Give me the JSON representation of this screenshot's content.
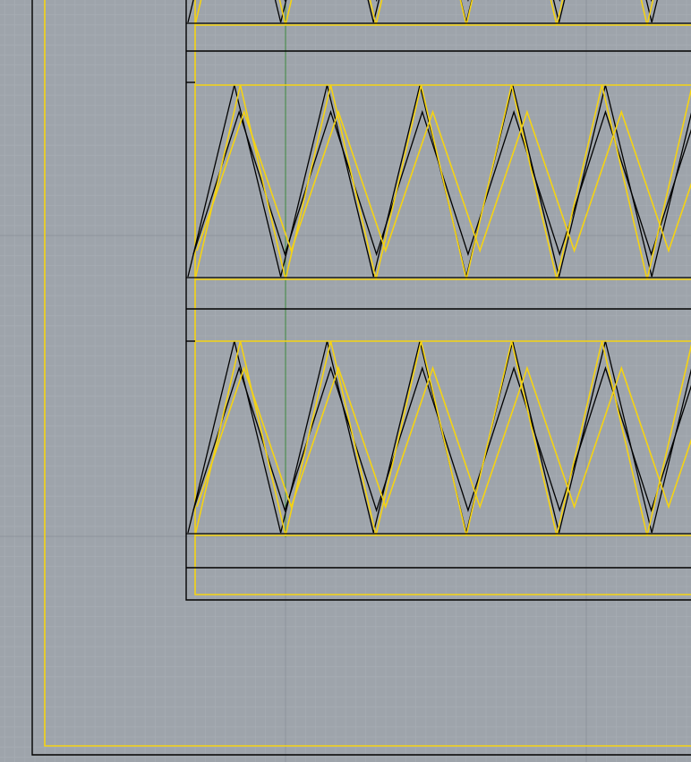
{
  "viewport": {
    "name": "top-viewport",
    "background": "#9ea4ab",
    "grid_minor_color": "#a6acb3",
    "grid_major_color": "#8f959c",
    "axis_y_color": "#3c8a3c",
    "object_color": "#000000",
    "selection_color": "#f5d312"
  },
  "geometry": {
    "outer_frame": {
      "label": "outer-frame"
    },
    "inner_frame": {
      "label": "inner-frame"
    },
    "zigzag_bands": [
      {
        "label": "zigzag-band-top"
      },
      {
        "label": "zigzag-band-middle"
      },
      {
        "label": "zigzag-band-bottom"
      }
    ]
  }
}
